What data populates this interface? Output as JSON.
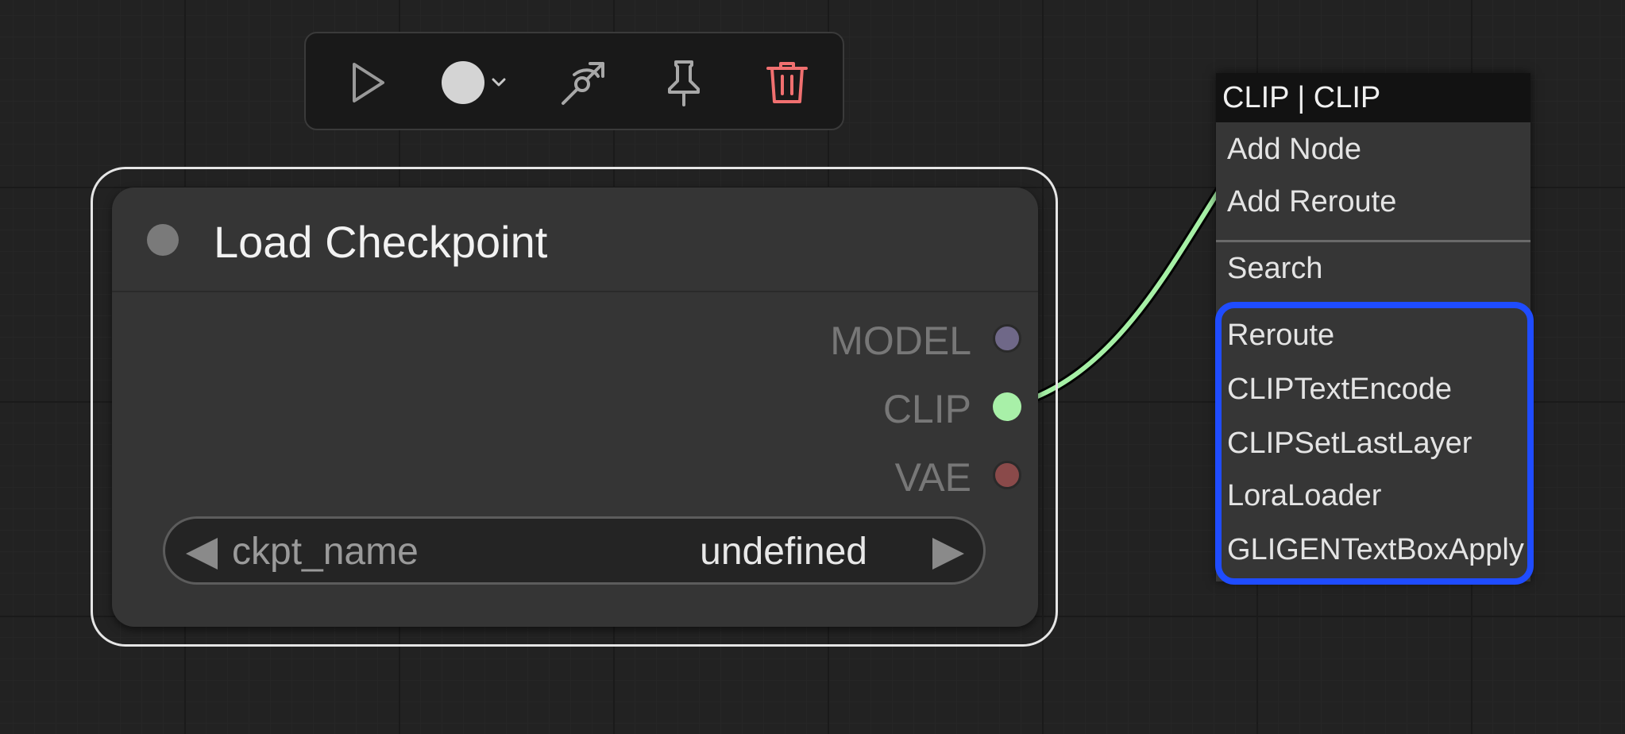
{
  "toolbox": {
    "buttons": [
      {
        "name": "execute",
        "icon": "play-icon"
      },
      {
        "name": "color",
        "icon": "circle-icon"
      },
      {
        "name": "bypass",
        "icon": "bypass-icon"
      },
      {
        "name": "pin",
        "icon": "pin-icon"
      },
      {
        "name": "delete",
        "icon": "trash-icon",
        "color": "#f07070"
      }
    ]
  },
  "node": {
    "title": "Load Checkpoint",
    "outputs": [
      {
        "label": "MODEL",
        "color": "#6f6888"
      },
      {
        "label": "CLIP",
        "color": "#a8f0a8"
      },
      {
        "label": "VAE",
        "color": "#8a4a4a"
      }
    ],
    "widget": {
      "name": "ckpt_name",
      "value": "undefined"
    }
  },
  "context_menu": {
    "title": "CLIP | CLIP",
    "items": [
      "Add Node",
      "Add Reroute"
    ],
    "search_label": "Search",
    "suggestions": [
      "Reroute",
      "CLIPTextEncode",
      "CLIPSetLastLayer",
      "LoraLoader",
      "GLIGENTextBoxApply"
    ],
    "highlight_color": "#1f4cff"
  },
  "link": {
    "color": "#a6f0a6"
  }
}
